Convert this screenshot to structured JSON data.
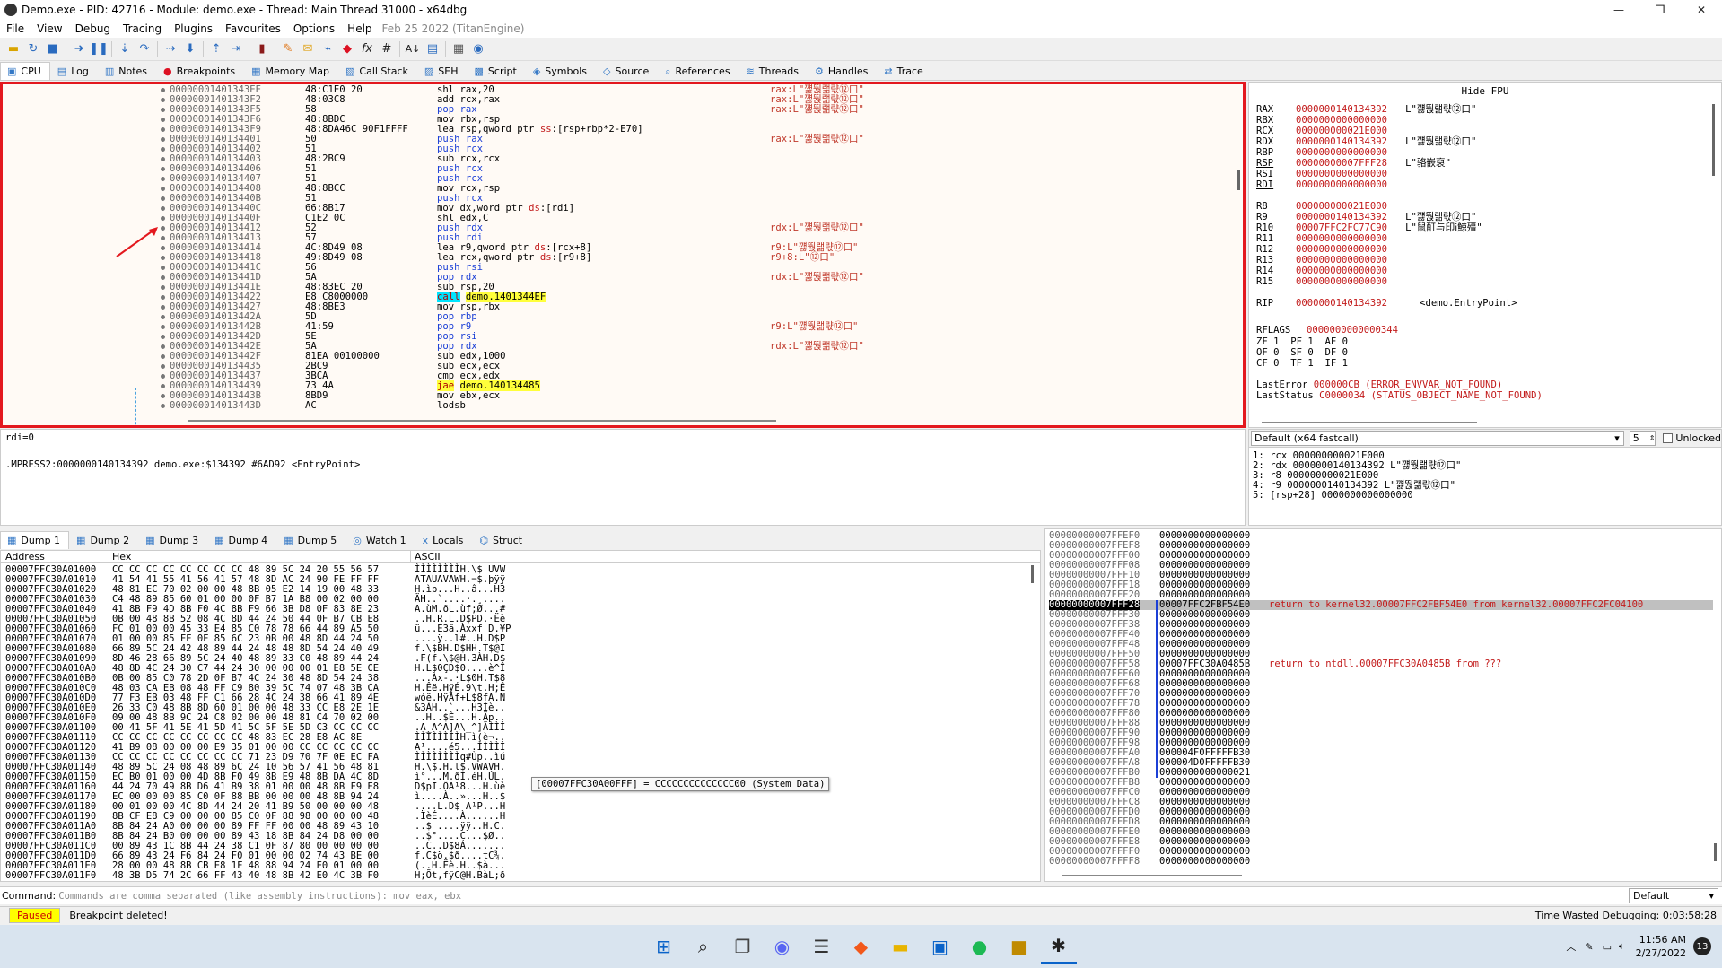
{
  "window": {
    "title": "Demo.exe - PID: 42716 - Module: demo.exe - Thread: Main Thread 31000 - x64dbg",
    "minimize": "—",
    "maximize": "❐",
    "close": "✕"
  },
  "menu": [
    "File",
    "View",
    "Debug",
    "Tracing",
    "Plugins",
    "Favourites",
    "Options",
    "Help"
  ],
  "menu_info": "Feb 25 2022 (TitanEngine)",
  "toolbar_icons": [
    "open-icon",
    "restart-icon",
    "stop-icon",
    "run-icon",
    "pause-icon",
    "step-into-icon",
    "step-over-icon",
    "trace-into-icon",
    "trace-over-icon",
    "execute-till-return-icon",
    "run-to-user-code-icon",
    "animate-icon",
    "scylla-icon",
    "patch-icon",
    "comment-icon",
    "label-icon",
    "bookmark-icon",
    "function-icon",
    "hash-icon",
    "font-icon",
    "strings-icon",
    "calculator-icon",
    "help-icon"
  ],
  "top_tabs": [
    {
      "label": "CPU",
      "icon": "cpu-icon",
      "active": true
    },
    {
      "label": "Log",
      "icon": "log-icon"
    },
    {
      "label": "Notes",
      "icon": "notes-icon"
    },
    {
      "label": "Breakpoints",
      "icon": "breakpoint-icon"
    },
    {
      "label": "Memory Map",
      "icon": "memory-map-icon"
    },
    {
      "label": "Call Stack",
      "icon": "call-stack-icon"
    },
    {
      "label": "SEH",
      "icon": "seh-icon"
    },
    {
      "label": "Script",
      "icon": "script-icon"
    },
    {
      "label": "Symbols",
      "icon": "symbols-icon"
    },
    {
      "label": "Source",
      "icon": "source-icon"
    },
    {
      "label": "References",
      "icon": "references-icon"
    },
    {
      "label": "Threads",
      "icon": "threads-icon"
    },
    {
      "label": "Handles",
      "icon": "handles-icon"
    },
    {
      "label": "Trace",
      "icon": "trace-icon"
    }
  ],
  "disasm": [
    {
      "addr": "00000001401343EE",
      "bytes": "48:C1E0 20",
      "instr": "shl rax,20",
      "cmt": "rax:L\"꺯뚽랢랷⑫口\""
    },
    {
      "addr": "00000001401343F2",
      "bytes": "48:03C8",
      "instr": "add rcx,rax",
      "cmt": "rax:L\"꺯뚽랢랷⑫口\""
    },
    {
      "addr": "00000001401343F5",
      "bytes": "58",
      "instr": "pop rax",
      "cmt": "rax:L\"꺯뚽랢랷⑫口\""
    },
    {
      "addr": "00000001401343F6",
      "bytes": "48:8BDC",
      "instr": "mov rbx,rsp",
      "cmt": ""
    },
    {
      "addr": "00000001401343F9",
      "bytes": "48:8DA46C 90F1FFFF",
      "instr": "lea rsp,qword ptr ss:[rsp+rbp*2-E70]",
      "cmt": ""
    },
    {
      "addr": "0000000140134401",
      "bytes": "50",
      "instr": "push rax",
      "cmt": "rax:L\"꺯뚽랢랷⑫口\""
    },
    {
      "addr": "0000000140134402",
      "bytes": "51",
      "instr": "push rcx",
      "cmt": ""
    },
    {
      "addr": "0000000140134403",
      "bytes": "48:2BC9",
      "instr": "sub rcx,rcx",
      "cmt": ""
    },
    {
      "addr": "0000000140134406",
      "bytes": "51",
      "instr": "push rcx",
      "cmt": ""
    },
    {
      "addr": "0000000140134407",
      "bytes": "51",
      "instr": "push rcx",
      "cmt": ""
    },
    {
      "addr": "0000000140134408",
      "bytes": "48:8BCC",
      "instr": "mov rcx,rsp",
      "cmt": ""
    },
    {
      "addr": "000000014013440B",
      "bytes": "51",
      "instr": "push rcx",
      "cmt": ""
    },
    {
      "addr": "000000014013440C",
      "bytes": "66:8B17",
      "instr": "mov dx,word ptr ds:[rdi]",
      "cmt": ""
    },
    {
      "addr": "000000014013440F",
      "bytes": "C1E2 0C",
      "instr": "shl edx,C",
      "cmt": ""
    },
    {
      "addr": "0000000140134412",
      "bytes": "52",
      "instr": "push rdx",
      "cmt": "rdx:L\"꺯뚽랢랷⑫口\""
    },
    {
      "addr": "0000000140134413",
      "bytes": "57",
      "instr": "push rdi",
      "cmt": ""
    },
    {
      "addr": "0000000140134414",
      "bytes": "4C:8D49 08",
      "instr": "lea r9,qword ptr ds:[rcx+8]",
      "cmt": "r9:L\"꺯뚽랢랷⑫口\""
    },
    {
      "addr": "0000000140134418",
      "bytes": "49:8D49 08",
      "instr": "lea rcx,qword ptr ds:[r9+8]",
      "cmt": "r9+8:L\"⑫口\""
    },
    {
      "addr": "000000014013441C",
      "bytes": "56",
      "instr": "push rsi",
      "cmt": ""
    },
    {
      "addr": "000000014013441D",
      "bytes": "5A",
      "instr": "pop rdx",
      "cmt": "rdx:L\"꺯뚽랢랷⑫口\""
    },
    {
      "addr": "000000014013441E",
      "bytes": "48:83EC 20",
      "instr": "sub rsp,20",
      "cmt": ""
    },
    {
      "addr": "0000000140134422",
      "bytes": "E8 C8000000",
      "instr": "call demo.1401344EF",
      "cmt": ""
    },
    {
      "addr": "0000000140134427",
      "bytes": "48:8BE3",
      "instr": "mov rsp,rbx",
      "cmt": ""
    },
    {
      "addr": "000000014013442A",
      "bytes": "5D",
      "instr": "pop rbp",
      "cmt": ""
    },
    {
      "addr": "000000014013442B",
      "bytes": "41:59",
      "instr": "pop r9",
      "cmt": "r9:L\"꺯뚽랢랷⑫口\""
    },
    {
      "addr": "000000014013442D",
      "bytes": "5E",
      "instr": "pop rsi",
      "cmt": ""
    },
    {
      "addr": "000000014013442E",
      "bytes": "5A",
      "instr": "pop rdx",
      "cmt": "rdx:L\"꺯뚽랢랷⑫口\""
    },
    {
      "addr": "000000014013442F",
      "bytes": "81EA 00100000",
      "instr": "sub edx,1000",
      "cmt": ""
    },
    {
      "addr": "0000000140134435",
      "bytes": "2BC9",
      "instr": "sub ecx,ecx",
      "cmt": ""
    },
    {
      "addr": "0000000140134437",
      "bytes": "3BCA",
      "instr": "cmp ecx,edx",
      "cmt": ""
    },
    {
      "addr": "0000000140134439",
      "bytes": "73 4A",
      "instr": "jae demo.140134485",
      "cmt": ""
    },
    {
      "addr": "000000014013443B",
      "bytes": "8BD9",
      "instr": "mov ebx,ecx",
      "cmt": ""
    },
    {
      "addr": "000000014013443D",
      "bytes": "AC",
      "instr": "lodsb",
      "cmt": ""
    }
  ],
  "fpu_header": "Hide FPU",
  "registers": [
    {
      "name": "RAX",
      "val": "0000000140134392",
      "str": "L\"꺯뚽랢랷⑫口\""
    },
    {
      "name": "RBX",
      "val": "0000000000000000",
      "str": ""
    },
    {
      "name": "RCX",
      "val": "000000000021E000",
      "str": ""
    },
    {
      "name": "RDX",
      "val": "0000000140134392",
      "str": "L\"꺯뚽랢랷⑫口\""
    },
    {
      "name": "RBP",
      "val": "0000000000000000",
      "str": ""
    },
    {
      "name": "RSP",
      "val": "00000000007FFF28",
      "str": "L\"骆嵌裒\""
    },
    {
      "name": "RSI",
      "val": "0000000000000000",
      "str": ""
    },
    {
      "name": "RDI",
      "val": "0000000000000000",
      "str": ""
    },
    {
      "name": "",
      "val": "",
      "str": ""
    },
    {
      "name": "R8",
      "val": "000000000021E000",
      "str": ""
    },
    {
      "name": "R9",
      "val": "0000000140134392",
      "str": "L\"꺯뚽랢랷⑫口\""
    },
    {
      "name": "R10",
      "val": "00007FFC2FC77C90",
      "str": "L\"鼠酊与印ⅰ鯨殭\""
    },
    {
      "name": "R11",
      "val": "0000000000000000",
      "str": ""
    },
    {
      "name": "R12",
      "val": "0000000000000000",
      "str": ""
    },
    {
      "name": "R13",
      "val": "0000000000000000",
      "str": ""
    },
    {
      "name": "R14",
      "val": "0000000000000000",
      "str": ""
    },
    {
      "name": "R15",
      "val": "0000000000000000",
      "str": ""
    },
    {
      "name": "",
      "val": "",
      "str": ""
    },
    {
      "name": "RIP",
      "val": "0000000140134392",
      "str": "<demo.EntryPoint>"
    }
  ],
  "rflags_label": "RFLAGS",
  "rflags_val": "0000000000000344",
  "flags": [
    "ZF 1  PF 1  AF 0",
    "OF 0  SF 0  DF 0",
    "CF 0  TF 1  IF 1"
  ],
  "lasterror_label": "LastError",
  "lasterror_val": "000000CB (ERROR_ENVVAR_NOT_FOUND)",
  "laststatus_label": "LastStatus",
  "laststatus_val": "C0000034 (STATUS_OBJECT_NAME_NOT_FOUND)",
  "info_line1": "rdi=0",
  "info_line2": ".MPRESS2:0000000140134392 demo.exe:$134392 #6AD92 <EntryPoint>",
  "callconv_select": "Default (x64 fastcall)",
  "callconv_count": "5",
  "callconv_unlocked": "Unlocked",
  "callconv_args": [
    "1: rcx 000000000021E000",
    "2: rdx 0000000140134392 L\"꺯뚽랢랷⑫口\"",
    "3: r8 000000000021E000",
    "4: r9 0000000140134392 L\"꺯뚽랢랷⑫口\"",
    "5: [rsp+28] 0000000000000000"
  ],
  "bottom_tabs": [
    {
      "label": "Dump 1",
      "icon": "dump-icon",
      "active": true
    },
    {
      "label": "Dump 2",
      "icon": "dump-icon"
    },
    {
      "label": "Dump 3",
      "icon": "dump-icon"
    },
    {
      "label": "Dump 4",
      "icon": "dump-icon"
    },
    {
      "label": "Dump 5",
      "icon": "dump-icon"
    },
    {
      "label": "Watch 1",
      "icon": "watch-icon"
    },
    {
      "label": "Locals",
      "icon": "locals-icon"
    },
    {
      "label": "Struct",
      "icon": "struct-icon"
    }
  ],
  "dump_headers": {
    "address": "Address",
    "hex": "Hex",
    "ascii": "ASCII"
  },
  "dump_rows": [
    {
      "a": "00007FFC30A01000",
      "h": "CC CC CC CC CC CC CC CC 48 89 5C 24 20 55 56 57",
      "c": "ÌÌÌÌÌÌÌÌH.\\$ UVW"
    },
    {
      "a": "00007FFC30A01010",
      "h": "41 54 41 55 41 56 41 57 48 8D AC 24 90 FE FF FF",
      "c": "ATAUAVAWH.¬$.þÿÿ"
    },
    {
      "a": "00007FFC30A01020",
      "h": "48 81 EC 70 02 00 00 48 8B 05 E2 14 19 00 48 33",
      "c": "H.ìp...H..â...H3"
    },
    {
      "a": "00007FFC30A01030",
      "h": "C4 48 89 85 60 01 00 00 0F B7 1A B8 00 02 00 00",
      "c": "ÄH..`....·.¸...."
    },
    {
      "a": "00007FFC30A01040",
      "h": "41 8B F9 4D 8B F0 4C 8B F9 66 3B D8 0F 83 8E 23",
      "c": "A.ùM.ðL.ùf;Ø...#"
    },
    {
      "a": "00007FFC30A01050",
      "h": "0B 00 48 8B 52 08 4C 8D 44 24 50 44 0F B7 CB E8",
      "c": "..H.R.L.D$PD.·Ëè"
    },
    {
      "a": "00007FFC30A01060",
      "h": "FC 01 00 00 45 33 E4 85 C0 78 78 66 44 89 A5 50",
      "c": "ü...E3ä.Àxxf D.¥P"
    },
    {
      "a": "00007FFC30A01070",
      "h": "01 00 00 85 FF 0F 85 6C 23 0B 00 48 8D 44 24 50",
      "c": "....ÿ..l#..H.D$P"
    },
    {
      "a": "00007FFC30A01080",
      "h": "66 89 5C 24 42 48 89 44 24 48 48 8D 54 24 40 49",
      "c": "f.\\$BH.D$HH.T$@I"
    },
    {
      "a": "00007FFC30A01090",
      "h": "8D 46 28 66 89 5C 24 40 48 89 33 C0 48 89 44 24",
      "c": ".F(f.\\$@H.3ÀH.D$"
    },
    {
      "a": "00007FFC30A010A0",
      "h": "48 8D 4C 24 30 C7 44 24 30 00 00 00 01 E8 5E CE",
      "c": "H.L$0ÇD$0....è^Î"
    },
    {
      "a": "00007FFC30A010B0",
      "h": "0B 00 85 C0 78 2D 0F B7 4C 24 30 48 8D 54 24 38",
      "c": "...Àx-.·L$0H.T$8"
    },
    {
      "a": "00007FFC30A010C0",
      "h": "48 03 CA EB 08 48 FF C9 80 39 5C 74 07 48 3B CA",
      "c": "H.Êë.HÿÉ.9\\t.H;Ê"
    },
    {
      "a": "00007FFC30A010D0",
      "h": "77 F3 EB 03 48 FF C1 66 28 4C 24 38 66 41 89 4E",
      "c": "wóë.HÿÁf+L$8fA.N"
    },
    {
      "a": "00007FFC30A010E0",
      "h": "26 33 C0 48 8B 8D 60 01 00 00 48 33 CC E8 2E 1E",
      "c": "&3ÀH..`...H3Ìè.."
    },
    {
      "a": "00007FFC30A010F0",
      "h": "09 00 48 8B 9C 24 C8 02 00 00 48 81 C4 70 02 00",
      "c": "..H..$È...H.Äp.."
    },
    {
      "a": "00007FFC30A01100",
      "h": "00 41 5F 41 5E 41 5D 41 5C 5F 5E 5D C3 CC CC CC",
      "c": ".A_A^A]A\\_^]ÃÌÌÌ"
    },
    {
      "a": "00007FFC30A01110",
      "h": "CC CC CC CC CC CC CC CC 48 83 EC 28 E8 AC 8E",
      "c": "ÌÌÌÌÌÌÌÌH.ì(è¬.."
    },
    {
      "a": "00007FFC30A01120",
      "h": "41 B9 08 00 00 00 E9 35 01 00 00 CC CC CC CC CC",
      "c": "A¹....é5...ÌÌÌÌÌ"
    },
    {
      "a": "00007FFC30A01130",
      "h": "CC CC CC CC CC CC CC CC 71 23 D9 70 7F 0E EC FA",
      "c": "ÌÌÌÌÌÌÌÌq#Ùp..ìú"
    },
    {
      "a": "00007FFC30A01140",
      "h": "48 89 5C 24 08 48 89 6C 24 10 56 57 41 56 48 81",
      "c": "H.\\$.H.l$.VWAVH."
    },
    {
      "a": "00007FFC30A01150",
      "h": "EC B0 01 00 00 4D 8B F0 49 8B E9 48 8B DA 4C 8D",
      "c": "ì°...M.ðI.éH.ÚL."
    },
    {
      "a": "00007FFC30A01160",
      "h": "44 24 70 49 8B D6 41 B9 38 01 00 00 48 8B F9 E8",
      "c": "D$pI.ÖA¹8...H.ùè"
    },
    {
      "a": "00007FFC30A01170",
      "h": "EC 00 00 00 85 C0 0F 88 BB 00 00 00 48 8B 94 24",
      "c": "ì....À..»...H..$"
    },
    {
      "a": "00007FFC30A01180",
      "h": "00 01 00 00 4C 8D 44 24 20 41 B9 50 00 00 00 48",
      "c": "....L.D$ A¹P...H"
    },
    {
      "a": "00007FFC30A01190",
      "h": "8B CF E8 C9 00 00 00 85 C0 0F 88 98 00 00 00 48",
      "c": ".ÏèÉ....À......H"
    },
    {
      "a": "00007FFC30A011A0",
      "h": "8B 84 24 A0 00 00 00 89 FF FF 00 00 48 89 43 10",
      "c": "..$ ....ÿÿ..H.C."
    },
    {
      "a": "00007FFC30A011B0",
      "h": "8B 84 24 B0 00 00 00 89 43 18 8B 84 24 D8 00 00",
      "c": "..$°....C...$Ø.."
    },
    {
      "a": "00007FFC30A011C0",
      "h": "00 89 43 1C 8B 44 24 38 C1 0F 87 80 00 00 00 00",
      "c": "..C..D$8Á......."
    },
    {
      "a": "00007FFC30A011D0",
      "h": "66 89 43 24 F6 84 24 F0 01 00 00 02 74 43 BE 00",
      "c": "f.C$ö.$ð....tC¾."
    },
    {
      "a": "00007FFC30A011E0",
      "h": "28 00 00 48 8B CB E8 1F 48 88 94 24 E0 01 00 00",
      "c": "(..H.Ëè.H..$à..."
    },
    {
      "a": "00007FFC30A011F0",
      "h": "48 3B D5 74 2C 66 FF 43 40 48 8B 42 E0 4C 3B F0",
      "c": "H;Õt,fÿC@H.BàL;ð"
    }
  ],
  "tooltip": "[00007FFC30A00FFF] = CCCCCCCCCCCCCC00 (System Data)",
  "stack_rows": [
    {
      "a": "00000000007FFEF0",
      "v": "0000000000000000",
      "c": ""
    },
    {
      "a": "00000000007FFEF8",
      "v": "0000000000000000",
      "c": ""
    },
    {
      "a": "00000000007FFF00",
      "v": "0000000000000000",
      "c": ""
    },
    {
      "a": "00000000007FFF08",
      "v": "0000000000000000",
      "c": ""
    },
    {
      "a": "00000000007FFF10",
      "v": "0000000000000000",
      "c": ""
    },
    {
      "a": "00000000007FFF18",
      "v": "0000000000000000",
      "c": ""
    },
    {
      "a": "00000000007FFF20",
      "v": "0000000000000000",
      "c": ""
    },
    {
      "a": "00000000007FFF28",
      "v": "00007FFC2FBF54E0",
      "c": "return to kernel32.00007FFC2FBF54E0 from kernel32.00007FFC2FC04100",
      "cur": true
    },
    {
      "a": "00000000007FFF30",
      "v": "0000000000000000",
      "c": ""
    },
    {
      "a": "00000000007FFF38",
      "v": "0000000000000000",
      "c": ""
    },
    {
      "a": "00000000007FFF40",
      "v": "0000000000000000",
      "c": ""
    },
    {
      "a": "00000000007FFF48",
      "v": "0000000000000000",
      "c": ""
    },
    {
      "a": "00000000007FFF50",
      "v": "0000000000000000",
      "c": ""
    },
    {
      "a": "00000000007FFF58",
      "v": "00007FFC30A0485B",
      "c": "return to ntdll.00007FFC30A0485B from ???"
    },
    {
      "a": "00000000007FFF60",
      "v": "0000000000000000",
      "c": ""
    },
    {
      "a": "00000000007FFF68",
      "v": "0000000000000000",
      "c": ""
    },
    {
      "a": "00000000007FFF70",
      "v": "0000000000000000",
      "c": ""
    },
    {
      "a": "00000000007FFF78",
      "v": "0000000000000000",
      "c": ""
    },
    {
      "a": "00000000007FFF80",
      "v": "0000000000000000",
      "c": ""
    },
    {
      "a": "00000000007FFF88",
      "v": "0000000000000000",
      "c": ""
    },
    {
      "a": "00000000007FFF90",
      "v": "0000000000000000",
      "c": ""
    },
    {
      "a": "00000000007FFF98",
      "v": "0000000000000000",
      "c": ""
    },
    {
      "a": "00000000007FFFA0",
      "v": "000004F0FFFFFB30",
      "c": ""
    },
    {
      "a": "00000000007FFFA8",
      "v": "000004D0FFFFFB30",
      "c": ""
    },
    {
      "a": "00000000007FFFB0",
      "v": "0000000000000021",
      "c": ""
    },
    {
      "a": "00000000007FFFB8",
      "v": "0000000000000000",
      "c": ""
    },
    {
      "a": "00000000007FFFC0",
      "v": "0000000000000000",
      "c": ""
    },
    {
      "a": "00000000007FFFC8",
      "v": "0000000000000000",
      "c": ""
    },
    {
      "a": "00000000007FFFD0",
      "v": "0000000000000000",
      "c": ""
    },
    {
      "a": "00000000007FFFD8",
      "v": "0000000000000000",
      "c": ""
    },
    {
      "a": "00000000007FFFE0",
      "v": "0000000000000000",
      "c": ""
    },
    {
      "a": "00000000007FFFE8",
      "v": "0000000000000000",
      "c": ""
    },
    {
      "a": "00000000007FFFF0",
      "v": "0000000000000000",
      "c": ""
    },
    {
      "a": "00000000007FFFF8",
      "v": "0000000000000000",
      "c": ""
    }
  ],
  "command_label": "Command:",
  "command_placeholder": "Commands are comma separated (like assembly instructions): mov eax, ebx",
  "command_mode": "Default",
  "status_state": "Paused",
  "status_msg": "Breakpoint deleted!",
  "status_wasted": "Time Wasted Debugging: 0:03:58:28",
  "clock_time": "11:56 AM",
  "clock_date": "2/27/2022",
  "notif_count": "13"
}
